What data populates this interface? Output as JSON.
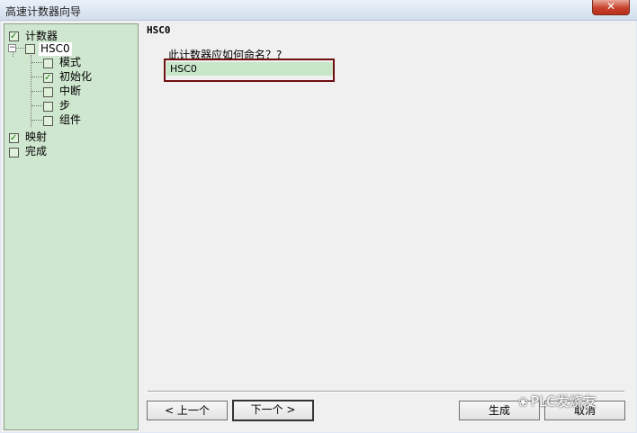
{
  "window": {
    "title": "高速计数器向导",
    "close_glyph": "✕"
  },
  "tree": {
    "items": [
      {
        "label": "计数器",
        "checked": true
      },
      {
        "label": "HSC0",
        "checked": false,
        "selected": true
      },
      {
        "label": "模式",
        "checked": false
      },
      {
        "label": "初始化",
        "checked": true
      },
      {
        "label": "中断",
        "checked": false
      },
      {
        "label": "步",
        "checked": false
      },
      {
        "label": "组件",
        "checked": false
      },
      {
        "label": "映射",
        "checked": true
      },
      {
        "label": "完成",
        "checked": false
      }
    ],
    "expander_glyph": "−"
  },
  "panel": {
    "title": "HSC0",
    "question": "此计数器应如何命名？?",
    "name_value": "HSC0"
  },
  "buttons": {
    "prev": "< 上一个",
    "next": "下一个 >",
    "generate": "生成",
    "cancel": "取消"
  },
  "watermark": {
    "icon": "❀",
    "text": "PLC发烧友"
  },
  "colors": {
    "tree_bg": "#cfe6cf",
    "input_bg": "#c8e6c8",
    "highlight_border": "#6e0f10"
  }
}
